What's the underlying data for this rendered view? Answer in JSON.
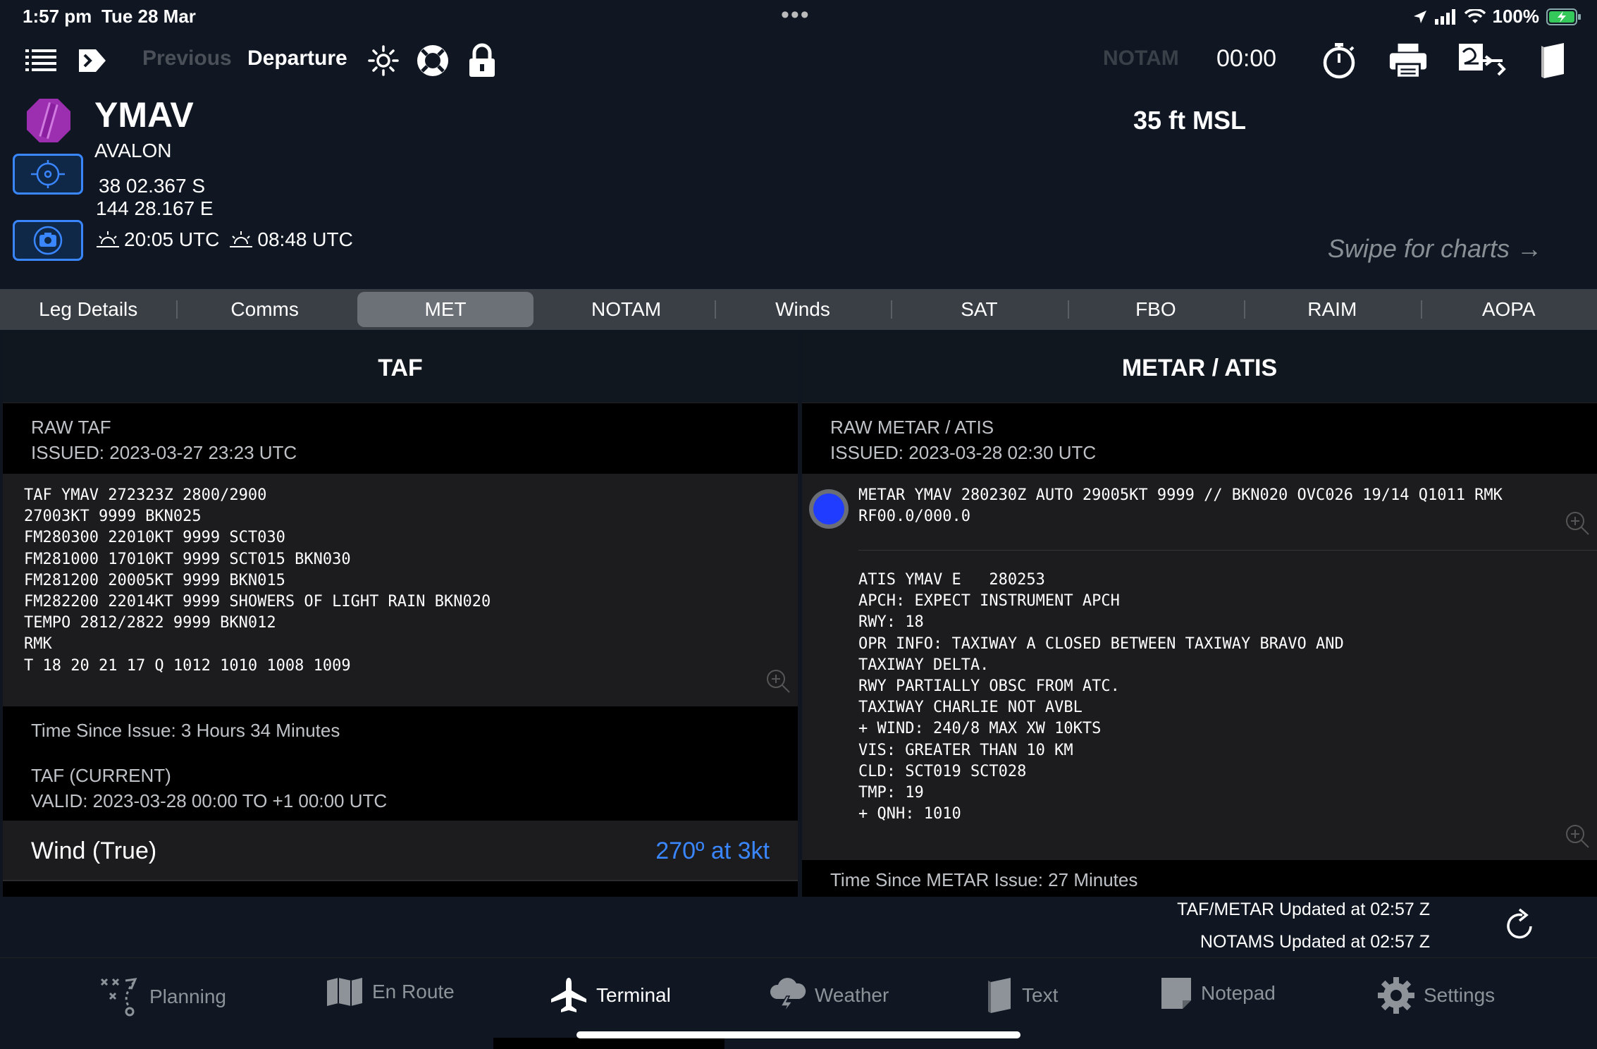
{
  "status": {
    "time": "1:57 pm",
    "date": "Tue 28 Mar",
    "battery": "100%"
  },
  "toolbar": {
    "previous": "Previous",
    "departure": "Departure",
    "notam": "NOTAM",
    "timer": "00:00"
  },
  "airport": {
    "ident": "YMAV",
    "name": "AVALON",
    "lat": "38 02.367 S",
    "lon": "144 28.167 E",
    "sunrise": "20:05 UTC",
    "sunset": "08:48 UTC",
    "elevation": "35 ft MSL",
    "swipe_hint": "Swipe for charts →"
  },
  "tabs": [
    "Leg Details",
    "Comms",
    "MET",
    "NOTAM",
    "Winds",
    "SAT",
    "FBO",
    "RAIM",
    "AOPA"
  ],
  "taf": {
    "title": "TAF",
    "raw_label": "RAW TAF",
    "issued": "ISSUED: 2023-03-27 23:23 UTC",
    "raw": "TAF YMAV 272323Z 2800/2900\n27003KT 9999 BKN025\nFM280300 22010KT 9999 SCT030\nFM281000 17010KT 9999 SCT015 BKN030\nFM281200 20005KT 9999 BKN015\nFM282200 22014KT 9999 SHOWERS OF LIGHT RAIN BKN020\nTEMPO 2812/2822 9999 BKN012\nRMK\nT 18 20 21 17 Q 1012 1010 1008 1009",
    "time_since": "Time Since Issue: 3 Hours 34 Minutes",
    "current_label": "TAF (CURRENT)",
    "valid": "VALID: 2023-03-28 00:00 TO +1 00:00 UTC",
    "wind_label": "Wind (True)",
    "wind_value": "270º at 3kt"
  },
  "metar": {
    "title": "METAR / ATIS",
    "raw_label": "RAW METAR / ATIS",
    "issued": "ISSUED: 2023-03-28 02:30 UTC",
    "raw": "METAR YMAV 280230Z AUTO 29005KT 9999 // BKN020 OVC026 19/14 Q1011 RMK\nRF00.0/000.0",
    "atis": "ATIS YMAV E   280253\nAPCH: EXPECT INSTRUMENT APCH\nRWY: 18\nOPR INFO: TAXIWAY A CLOSED BETWEEN TAXIWAY BRAVO AND\nTAXIWAY DELTA.\nRWY PARTIALLY OBSC FROM ATC.\nTAXIWAY CHARLIE NOT AVBL\n+ WIND: 240/8 MAX XW 10KTS\nVIS: GREATER THAN 10 KM\nCLD: SCT019 SCT028\nTMP: 19\n+ QNH: 1010",
    "time_since": "Time Since METAR Issue: 27 Minutes"
  },
  "updates": {
    "taf_metar": "TAF/METAR Updated at 02:57 Z",
    "notams": "NOTAMS Updated at 02:57 Z"
  },
  "bottom_tabs": {
    "planning": "Planning",
    "enroute": "En Route",
    "terminal": "Terminal",
    "weather": "Weather",
    "text": "Text",
    "notepad": "Notepad",
    "settings": "Settings"
  }
}
